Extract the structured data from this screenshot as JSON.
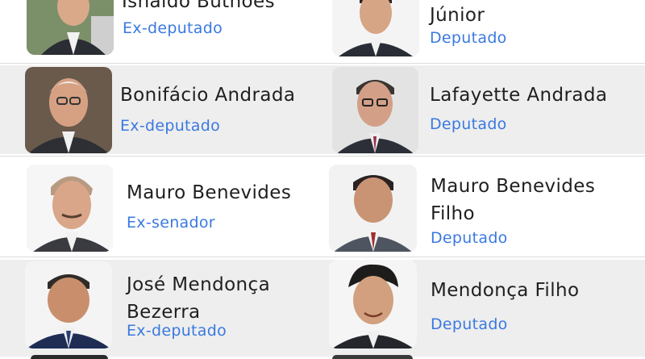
{
  "list": {
    "rows": [
      {
        "left": {
          "name": "Ishaldo Buthões",
          "role": "Ex-deputado"
        },
        "right": {
          "name": "Júnior",
          "role": "Deputado"
        }
      },
      {
        "left": {
          "name": "Bonifácio Andrada",
          "role": "Ex-deputado"
        },
        "right": {
          "name": "Lafayette Andrada",
          "role": "Deputado"
        }
      },
      {
        "left": {
          "name": "Mauro Benevides",
          "role": "Ex-senador"
        },
        "right": {
          "name_line1": "Mauro Benevides",
          "name_line2": "Filho",
          "role": "Deputado"
        }
      },
      {
        "left": {
          "name_line1": "José Mendonça",
          "name_line2": "Bezerra",
          "role": "Ex-deputado"
        },
        "right": {
          "name": "Mendonça Filho",
          "role": "Deputado"
        }
      }
    ]
  },
  "colors": {
    "role_text": "#3a79e0",
    "row_alt_bg": "#eeeeee"
  }
}
